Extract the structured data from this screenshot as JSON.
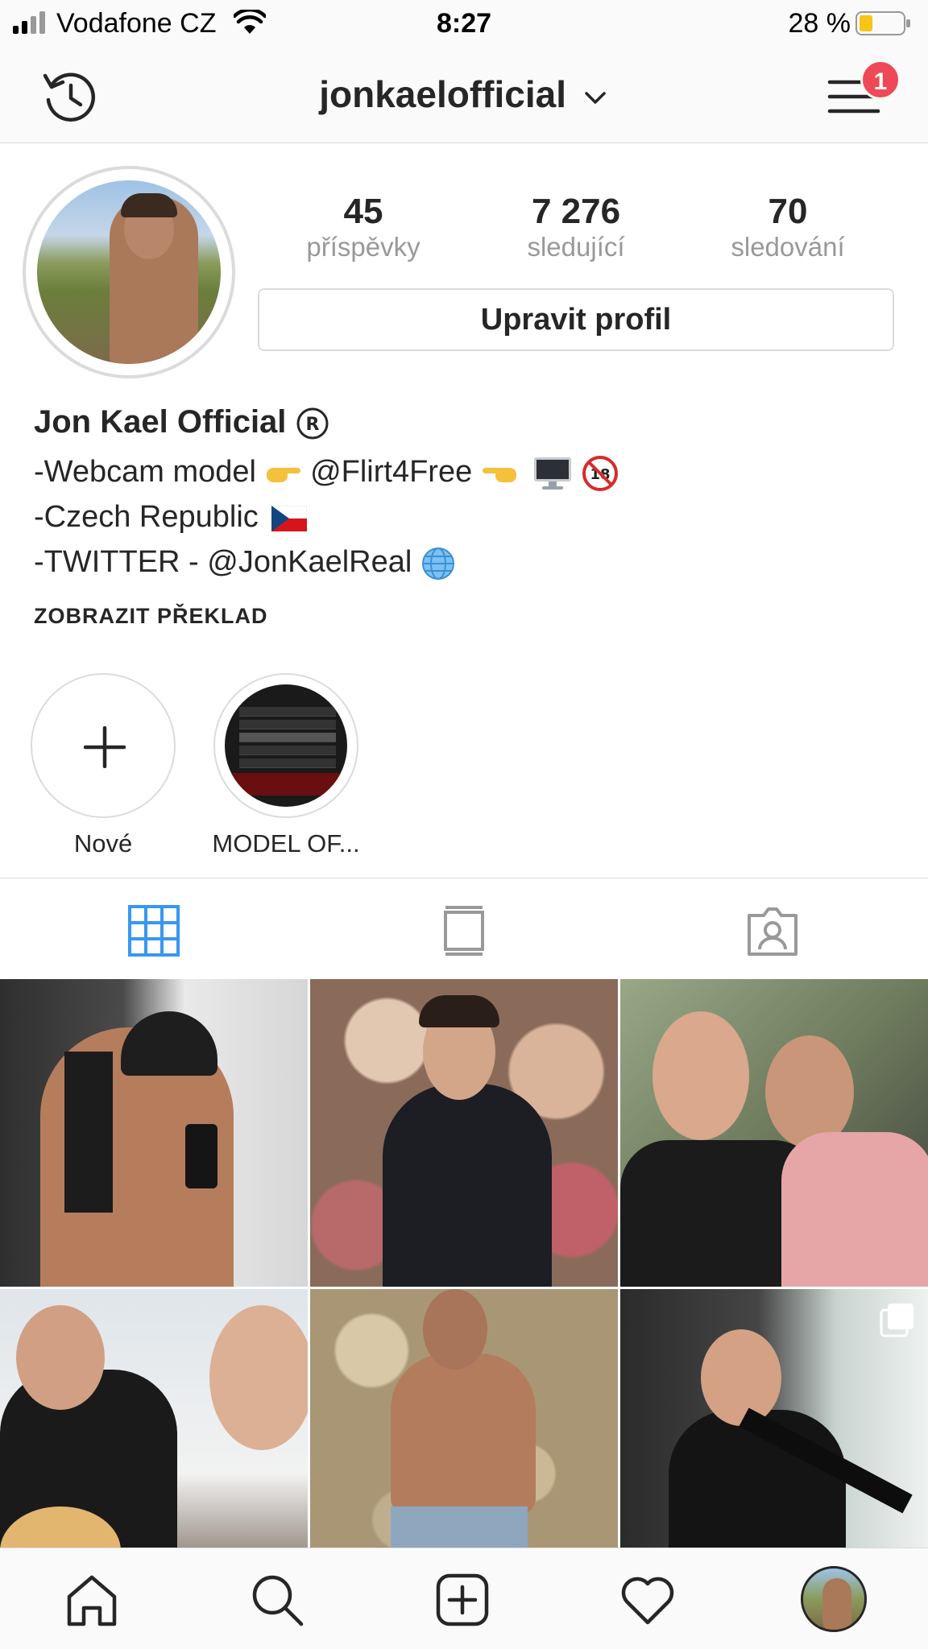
{
  "status_bar": {
    "carrier": "Vodafone CZ",
    "time": "8:27",
    "battery_text": "28 %"
  },
  "header": {
    "username": "jonkaelofficial",
    "notification_count": "1"
  },
  "profile": {
    "stats": [
      {
        "value": "45",
        "label": "příspěvky"
      },
      {
        "value": "7 276",
        "label": "sledující"
      },
      {
        "value": "70",
        "label": "sledování"
      }
    ],
    "edit_button": "Upravit profil",
    "full_name": "Jon Kael Official",
    "bio_lines": {
      "line1": "-Webcam model",
      "line1_handle": "@Flirt4Free",
      "line2": "-Czech Republic",
      "line3": "-TWITTER - @JonKaelReal"
    },
    "translate_link": "ZOBRAZIT PŘEKLAD"
  },
  "highlights": [
    {
      "label": "Nové"
    },
    {
      "label": "MODEL OF..."
    }
  ],
  "tabs": [
    {
      "icon": "grid-icon",
      "active": true
    },
    {
      "icon": "feed-icon",
      "active": false
    },
    {
      "icon": "tagged-icon",
      "active": false
    }
  ],
  "colors": {
    "accent": "#3897f0",
    "badge": "#ed4956",
    "text": "#262626",
    "muted": "#999999",
    "border": "#dbdbdb"
  }
}
